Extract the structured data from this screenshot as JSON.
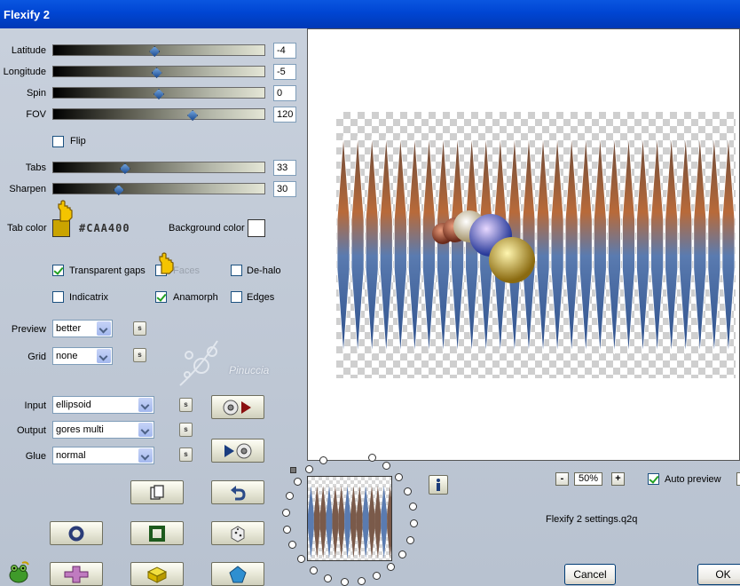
{
  "window": {
    "title": "Flexify 2"
  },
  "sliders": [
    {
      "key": "latitude",
      "label": "Latitude",
      "value": "-4",
      "fraction": 0.48
    },
    {
      "key": "longitude",
      "label": "Longitude",
      "value": "-5",
      "fraction": 0.49
    },
    {
      "key": "spin",
      "label": "Spin",
      "value": "0",
      "fraction": 0.5
    },
    {
      "key": "fov",
      "label": "FOV",
      "value": "120",
      "fraction": 0.66
    },
    {
      "key": "tabs",
      "label": "Tabs",
      "value": "33",
      "fraction": 0.34
    },
    {
      "key": "sharpen",
      "label": "Sharpen",
      "value": "30",
      "fraction": 0.31
    }
  ],
  "flip": {
    "label": "Flip",
    "checked": false
  },
  "tab_color": {
    "label": "Tab color",
    "hex": "#CAA400",
    "color": "#caa400"
  },
  "background_color": {
    "label": "Background color",
    "color": "#ffffff"
  },
  "options": {
    "transparent_gaps": {
      "label": "Transparent gaps",
      "checked": true
    },
    "faces": {
      "label": "Faces",
      "checked": false
    },
    "de_halo": {
      "label": "De-halo",
      "checked": false
    },
    "indicatrix": {
      "label": "Indicatrix",
      "checked": false
    },
    "anamorph": {
      "label": "Anamorph",
      "checked": true
    },
    "edges": {
      "label": "Edges",
      "checked": false
    }
  },
  "selects": {
    "preview": {
      "label": "Preview",
      "value": "better"
    },
    "grid": {
      "label": "Grid",
      "value": "none"
    },
    "input": {
      "label": "Input",
      "value": "ellipsoid"
    },
    "output": {
      "label": "Output",
      "value": "gores multi"
    },
    "glue": {
      "label": "Glue",
      "value": "normal"
    }
  },
  "small_button_label": "s",
  "watermark": "Pinuccia",
  "zoom": {
    "value": "50%",
    "minus": "-",
    "plus": "+"
  },
  "auto_preview": {
    "label": "Auto preview",
    "checked": true
  },
  "settings_file": "Flexify 2 settings.q2q",
  "buttons": {
    "cancel": "Cancel",
    "ok": "OK"
  },
  "icons": {
    "tool_copy": "copy-pages-icon",
    "tool_undo": "undo-arrow-icon",
    "tool_ring": "ring-icon",
    "tool_square": "square-frame-icon",
    "tool_dice": "dice-icon",
    "tool_cross": "cross-icon",
    "tool_cube": "cube-icon",
    "tool_pentagon": "pentagon-icon",
    "media_input": "disc-play-icon",
    "media_output": "play-disc-icon",
    "info": "info-icon",
    "hand_cursor": "pointing-hand-icon",
    "logo": "green-frog-icon"
  },
  "colors": {
    "title_bar": "#0a56e0",
    "panel": "#c2cbd8",
    "slider_thumb": "#1f4f96"
  }
}
